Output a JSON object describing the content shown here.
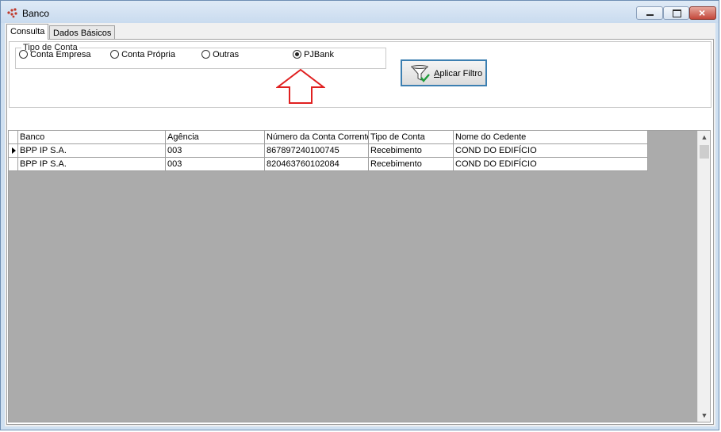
{
  "window": {
    "title": "Banco"
  },
  "tabs": [
    {
      "label": "Consulta"
    },
    {
      "label": "Dados Básicos"
    }
  ],
  "filter": {
    "group_label": "Tipo de Conta",
    "options": [
      {
        "label": "Conta Empresa",
        "selected": false
      },
      {
        "label": "Conta Própria",
        "selected": false
      },
      {
        "label": "Outras",
        "selected": false
      },
      {
        "label": "PJBank",
        "selected": true
      }
    ],
    "apply_prefix": "A",
    "apply_rest": "plicar Filtro",
    "annotation_color": "#e02020"
  },
  "grid": {
    "columns": [
      "Banco",
      "Agência",
      "Número da Conta Corrente",
      "Tipo de Conta",
      "Nome do Cedente"
    ],
    "rows": [
      [
        "BPP IP S.A.",
        "003",
        "867897240100745",
        "Recebimento",
        "COND DO EDIFÍCIO"
      ],
      [
        "BPP IP S.A.",
        "003",
        "820463760102084",
        "Recebimento",
        "COND DO EDIFÍCIO"
      ]
    ]
  }
}
